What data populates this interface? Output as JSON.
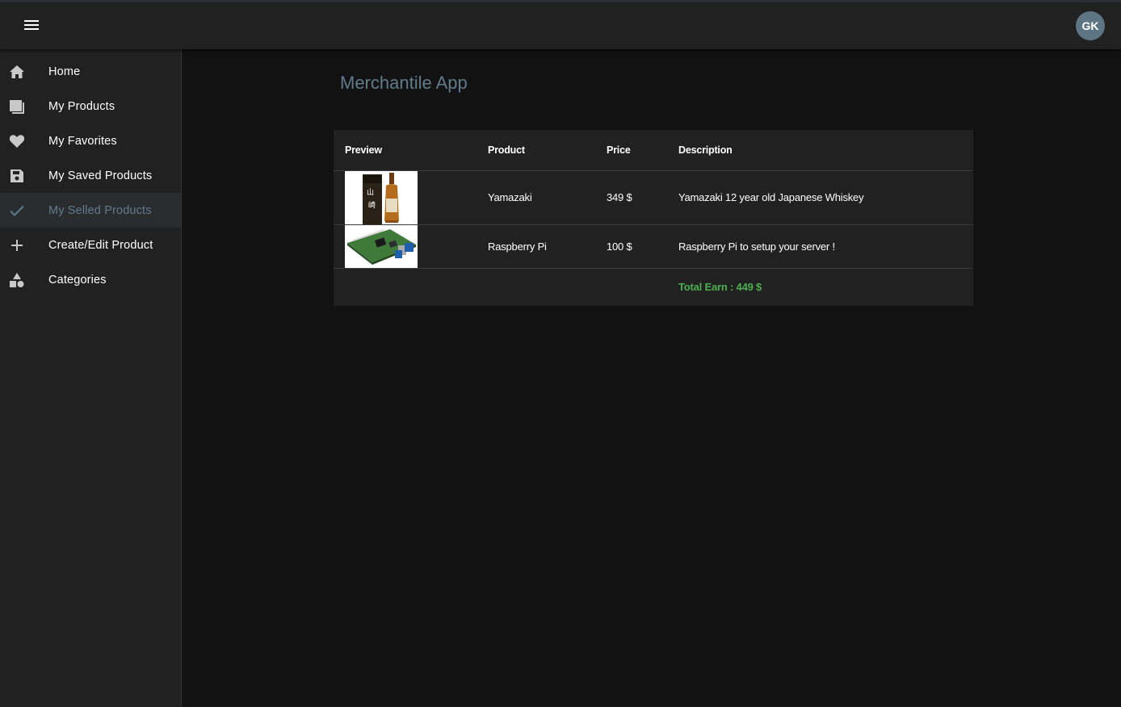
{
  "header": {
    "menu_icon": "hamburger-menu-icon",
    "avatar_initials": "GK",
    "avatar_color": "#5d7584"
  },
  "sidebar": {
    "items": [
      {
        "label": "Home",
        "icon": "home-icon",
        "active": false
      },
      {
        "label": "My Products",
        "icon": "products-icon",
        "active": false
      },
      {
        "label": "My Favorites",
        "icon": "heart-icon",
        "active": false
      },
      {
        "label": "My Saved Products",
        "icon": "save-icon",
        "active": false
      },
      {
        "label": "My Selled Products",
        "icon": "check-icon",
        "active": true
      },
      {
        "label": "Create/Edit Product",
        "icon": "plus-icon",
        "active": false
      },
      {
        "label": "Categories",
        "icon": "categories-icon",
        "active": false
      }
    ]
  },
  "main": {
    "title": "Merchantile App",
    "table": {
      "columns": [
        "Preview",
        "Product",
        "Price",
        "Description"
      ],
      "rows": [
        {
          "preview": "whisky-bottle-image",
          "product": "Yamazaki",
          "price": "349 $",
          "description": "Yamazaki 12 year old Japanese Whiskey"
        },
        {
          "preview": "raspberry-pi-board-image",
          "product": "Raspberry Pi",
          "price": "100 $",
          "description": "Raspberry Pi to setup your server !"
        }
      ],
      "total": "Total Earn : 449 $"
    }
  },
  "colors": {
    "accent": "#617b8b",
    "total": "#4caf50",
    "background": "#121212",
    "surface": "#212121"
  }
}
